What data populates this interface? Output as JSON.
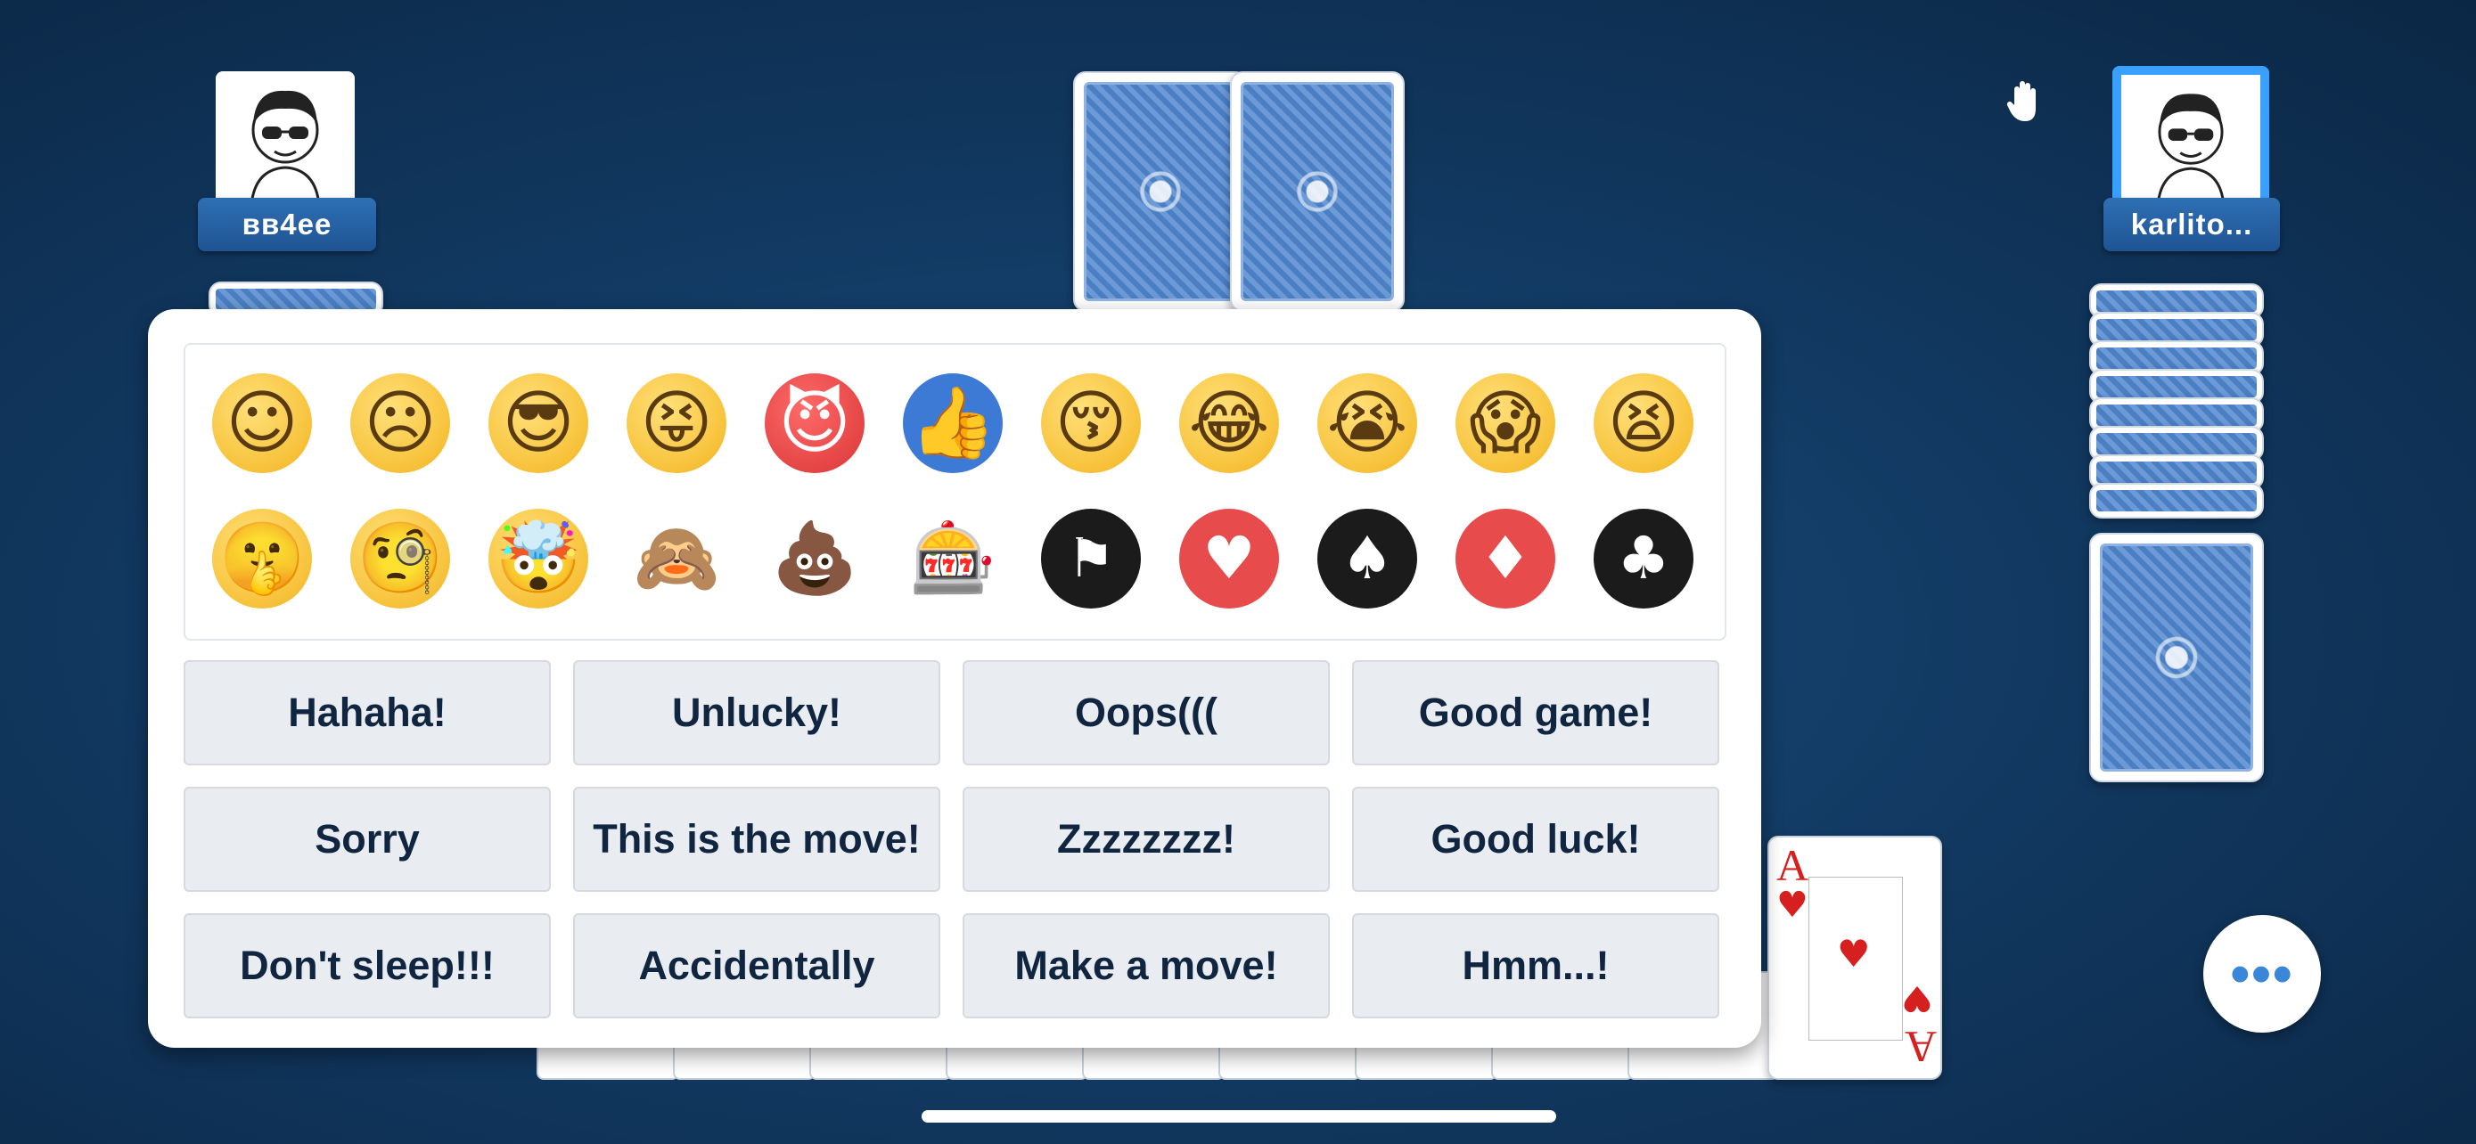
{
  "players": {
    "left": {
      "name": "вв4ee"
    },
    "right": {
      "name": "karlito..."
    }
  },
  "emojis": [
    [
      "☺",
      "☹",
      "😎",
      "😝",
      "😈",
      "👍",
      "😚",
      "😂",
      "😭",
      "😱",
      "😫"
    ],
    [
      "🤫",
      "🧐",
      "🤯",
      "🙈",
      "💩",
      "🎰",
      "⚑",
      "♥",
      "♠",
      "♦",
      "♣"
    ]
  ],
  "messages": [
    [
      "Hahaha!",
      "Unlucky!",
      "Oops(((",
      "Good game!"
    ],
    [
      "Sorry",
      "This is the move!",
      "Zzzzzzzz!",
      "Good luck!"
    ],
    [
      "Don't sleep!!!",
      "Accidentally",
      "Make a move!",
      "Hmm...!"
    ]
  ],
  "ace_card": {
    "rank": "A",
    "suit": "♥"
  },
  "more_button": {
    "label": "•••"
  },
  "icons": {
    "hand": "raise-hand-icon"
  },
  "colors": {
    "accent": "#3aa0ff",
    "background": "#123a63"
  }
}
